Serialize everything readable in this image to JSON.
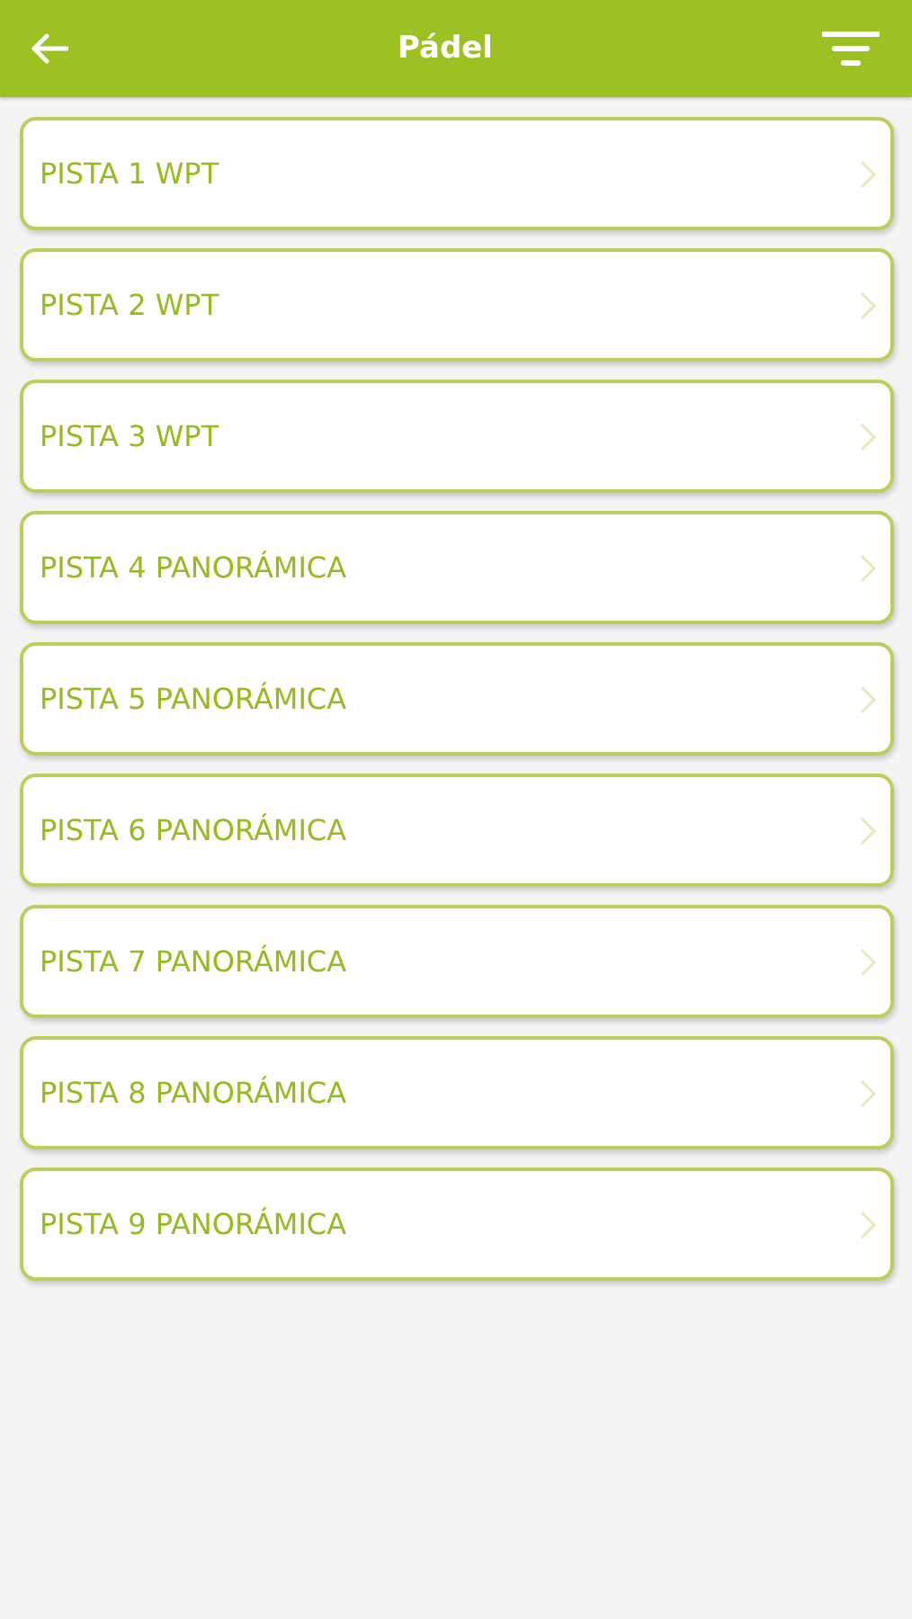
{
  "header": {
    "title": "Pádel"
  },
  "courts": [
    {
      "name": "PISTA 1 WPT"
    },
    {
      "name": "PISTA 2 WPT"
    },
    {
      "name": "PISTA 3 WPT"
    },
    {
      "name": "PISTA 4 PANORÁMICA"
    },
    {
      "name": "PISTA 5 PANORÁMICA"
    },
    {
      "name": "PISTA 6 PANORÁMICA"
    },
    {
      "name": "PISTA 7 PANORÁMICA"
    },
    {
      "name": "PISTA 8 PANORÁMICA"
    },
    {
      "name": "PISTA 9 PANORÁMICA"
    }
  ]
}
